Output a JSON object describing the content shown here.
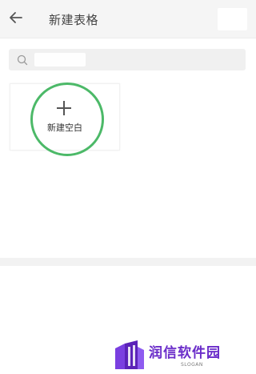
{
  "header": {
    "title": "新建表格",
    "back_icon": "arrow-left-icon"
  },
  "search": {
    "icon": "search-icon",
    "value": "",
    "placeholder": ""
  },
  "templates": {
    "new_blank": {
      "label": "新建空白",
      "icon": "plus-icon",
      "highlight_color": "#4cb968"
    }
  },
  "watermark": {
    "brand": "润信软件园",
    "slogan": "SLOGAN",
    "brand_color": "#6a2cc9"
  }
}
